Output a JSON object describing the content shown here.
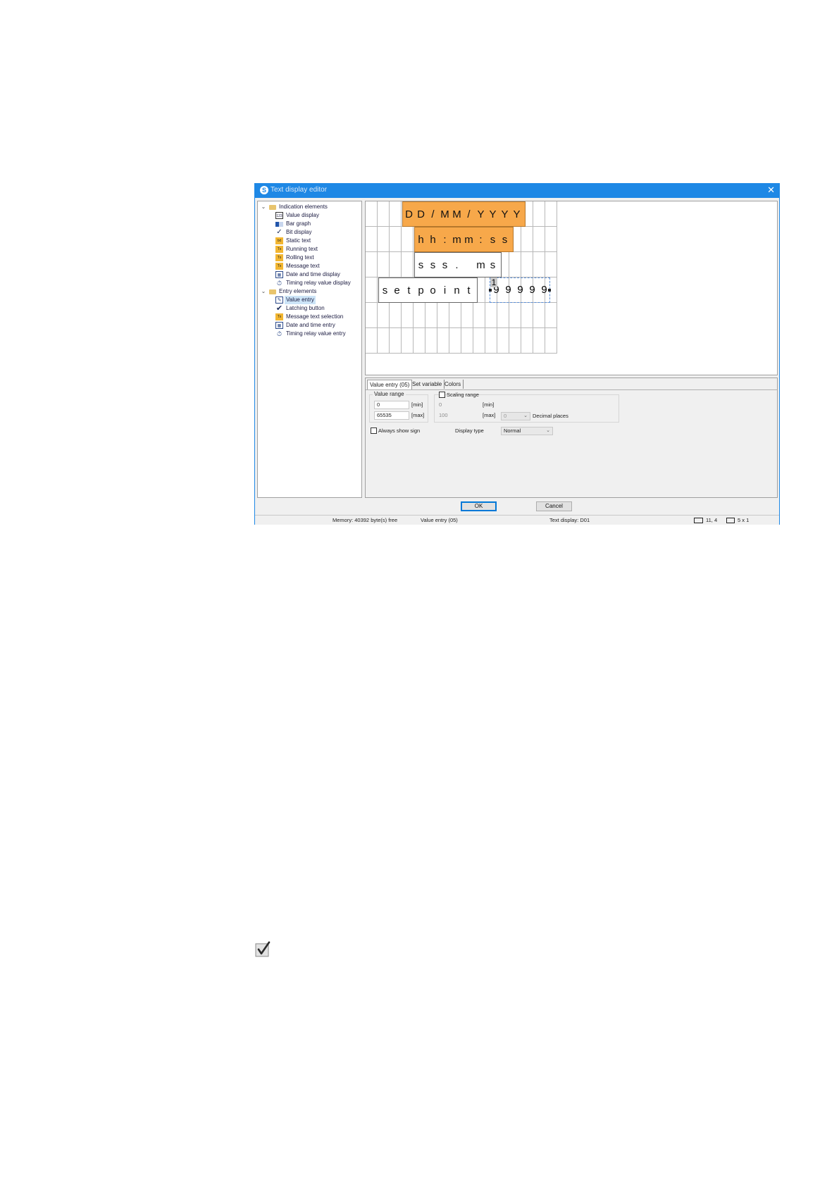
{
  "window": {
    "title": "Text display editor",
    "close_glyph": "✕"
  },
  "tree": {
    "groups": [
      {
        "label": "Indication elements",
        "icon": "folder-icon",
        "items": [
          {
            "label": "Value display",
            "icon": "value-display-icon",
            "glyph": "123"
          },
          {
            "label": "Bar graph",
            "icon": "bar-graph-icon",
            "glyph": "▮"
          },
          {
            "label": "Bit display",
            "icon": "checkmark-icon",
            "glyph": "✓"
          },
          {
            "label": "Static text",
            "icon": "static-text-icon",
            "glyph": "txt"
          },
          {
            "label": "Running text",
            "icon": "running-text-icon",
            "glyph": "Tx"
          },
          {
            "label": "Rolling text",
            "icon": "rolling-text-icon",
            "glyph": "Tx"
          },
          {
            "label": "Message text",
            "icon": "message-text-icon",
            "glyph": "Tx"
          },
          {
            "label": "Date and time display",
            "icon": "date-time-icon",
            "glyph": "▦"
          },
          {
            "label": "Timing relay value display",
            "icon": "timing-relay-icon",
            "glyph": "⏱"
          }
        ]
      },
      {
        "label": "Entry elements",
        "icon": "folder-icon",
        "items": [
          {
            "label": "Value entry",
            "icon": "value-entry-icon",
            "glyph": "✎",
            "selected": true
          },
          {
            "label": "Latching button",
            "icon": "checkmark-icon",
            "glyph": "✔"
          },
          {
            "label": "Message text selection",
            "icon": "message-select-icon",
            "glyph": "Tx"
          },
          {
            "label": "Date and time entry",
            "icon": "date-time-entry-icon",
            "glyph": "▦"
          },
          {
            "label": "Timing relay value entry",
            "icon": "timing-relay-entry-icon",
            "glyph": "⏱"
          }
        ]
      }
    ]
  },
  "canvas": {
    "elements": [
      {
        "name": "date-element",
        "text": "DD/MM/YYYY",
        "style": "orange"
      },
      {
        "name": "time-element",
        "text": "hh:mm:ss",
        "style": "orange"
      },
      {
        "name": "millis-element",
        "text": "sss. ms",
        "style": "plain"
      },
      {
        "name": "setpoint-label",
        "text": "setpoint",
        "style": "plain"
      },
      {
        "name": "value-entry-field",
        "text": "99999",
        "marker": "1",
        "style": "selected"
      }
    ]
  },
  "tabs": [
    {
      "label": "Value entry (05)",
      "active": true
    },
    {
      "label": "Set variable",
      "active": false
    },
    {
      "label": "Colors",
      "active": false
    }
  ],
  "value_entry": {
    "value_range_label": "Value range",
    "min_value": "0",
    "max_value": "65535",
    "min_unit": "[min]",
    "max_unit": "[max]",
    "scaling_range_label": "Scaling range",
    "scaling_checked": false,
    "scaling_min": "0",
    "scaling_max": "100",
    "scaling_min_unit": "[min]",
    "scaling_max_unit": "[max]",
    "decimal_places_value": "0",
    "decimal_places_label": "Decimal places",
    "always_show_sign_label": "Always show sign",
    "always_show_sign_checked": false,
    "display_type_label": "Display type",
    "display_type_value": "Normal"
  },
  "buttons": {
    "ok": "OK",
    "cancel": "Cancel"
  },
  "statusbar": {
    "memory": "Memory: 40392 byte(s) free",
    "element": "Value entry (05)",
    "text_display": "Text display: D01",
    "position": "11, 4",
    "size": "5 x 1"
  },
  "page_icon": "checkbox-checked-icon"
}
